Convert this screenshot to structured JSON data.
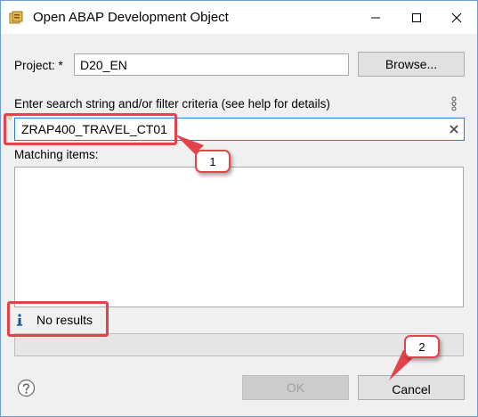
{
  "window": {
    "title": "Open ABAP Development Object"
  },
  "form": {
    "project_label": "Project: *",
    "project_value": "D20_EN",
    "browse_label": "Browse...",
    "search_label": "Enter search string and/or filter criteria (see help for details)",
    "search_value": "ZRAP400_TRAVEL_CT01",
    "matching_label": "Matching items:",
    "status_text": "No results"
  },
  "buttons": {
    "ok_label": "OK",
    "cancel_label": "Cancel"
  },
  "annotations": {
    "callout_1": "1",
    "callout_2": "2"
  },
  "colors": {
    "annotation_red": "#e5434a",
    "info_blue": "#1e4fa3"
  },
  "icons": {
    "app": "abap-object-icon",
    "minimize": "minimize-icon",
    "maximize": "maximize-icon",
    "close": "close-icon",
    "menu": "vertical-dots-icon",
    "clear": "clear-x-icon",
    "info": "info-icon",
    "help": "help-icon"
  }
}
